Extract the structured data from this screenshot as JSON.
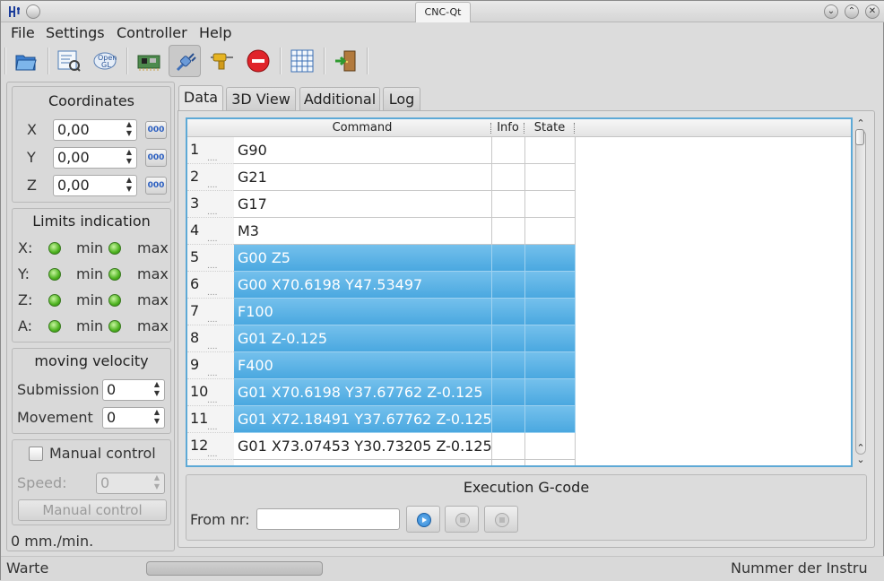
{
  "window": {
    "title": "CNC-Qt",
    "app_icon": "fork-icon"
  },
  "menu": [
    "File",
    "Settings",
    "Controller",
    "Help"
  ],
  "toolbar": {
    "groups": [
      [
        "open-folder-icon"
      ],
      [
        "settings-dialog-icon",
        "opengl-icon"
      ],
      [
        "controller-board-icon",
        "connect-plug-icon",
        "spindle-drill-icon",
        "stop-icon"
      ],
      [
        "grid-icon"
      ],
      [
        "exit-door-icon"
      ]
    ],
    "active": "connect-plug-icon"
  },
  "coordinates": {
    "title": "Coordinates",
    "axes": [
      {
        "label": "X",
        "value": "0,00",
        "button": "000"
      },
      {
        "label": "Y",
        "value": "0,00",
        "button": "000"
      },
      {
        "label": "Z",
        "value": "0,00",
        "button": "000"
      }
    ]
  },
  "limits": {
    "title": "Limits indication",
    "rows": [
      {
        "axis": "X:",
        "min": "min",
        "max": "max"
      },
      {
        "axis": "Y:",
        "min": "min",
        "max": "max"
      },
      {
        "axis": "Z:",
        "min": "min",
        "max": "max"
      },
      {
        "axis": "A:",
        "min": "min",
        "max": "max"
      }
    ]
  },
  "velocity": {
    "title": "moving velocity",
    "submission_label": "Submission",
    "submission_value": "0",
    "movement_label": "Movement",
    "movement_value": "0"
  },
  "manual": {
    "checkbox_label": "Manual control",
    "checked": false,
    "speed_label": "Speed:",
    "speed_value": "0",
    "button_label": "Manual control"
  },
  "speed_status": "0 mm./min.",
  "tabs": [
    "Data",
    "3D View",
    "Additional",
    "Log"
  ],
  "active_tab": "Data",
  "table": {
    "headers": [
      "Command",
      "Info",
      "State"
    ],
    "rows": [
      {
        "num": "1",
        "command": "G90",
        "selected": false
      },
      {
        "num": "2",
        "command": "G21",
        "selected": false
      },
      {
        "num": "3",
        "command": "G17",
        "selected": false
      },
      {
        "num": "4",
        "command": "M3",
        "selected": false
      },
      {
        "num": "5",
        "command": "G00 Z5",
        "selected": true
      },
      {
        "num": "6",
        "command": "G00 X70.6198 Y47.53497",
        "selected": true
      },
      {
        "num": "7",
        "command": "F100",
        "selected": true
      },
      {
        "num": "8",
        "command": "G01 Z-0.125",
        "selected": true
      },
      {
        "num": "9",
        "command": "F400",
        "selected": true
      },
      {
        "num": "10",
        "command": "G01 X70.6198 Y37.67762 Z-0.125",
        "selected": true
      },
      {
        "num": "11",
        "command": "G01 X72.18491 Y37.67762 Z-0.125",
        "selected": true
      },
      {
        "num": "12",
        "command": "G01 X73.07453 Y30.73205 Z-0.125",
        "selected": false
      }
    ]
  },
  "execution": {
    "title": "Execution G-code",
    "from_label": "From nr:",
    "from_value": ""
  },
  "status": {
    "left": "Warte",
    "right": "Nummer der Instru"
  },
  "colors": {
    "selection": "#5ab4e6",
    "led_green": "#4eb320",
    "stop_red": "#e0242a",
    "focus_border": "#5da9d6"
  }
}
